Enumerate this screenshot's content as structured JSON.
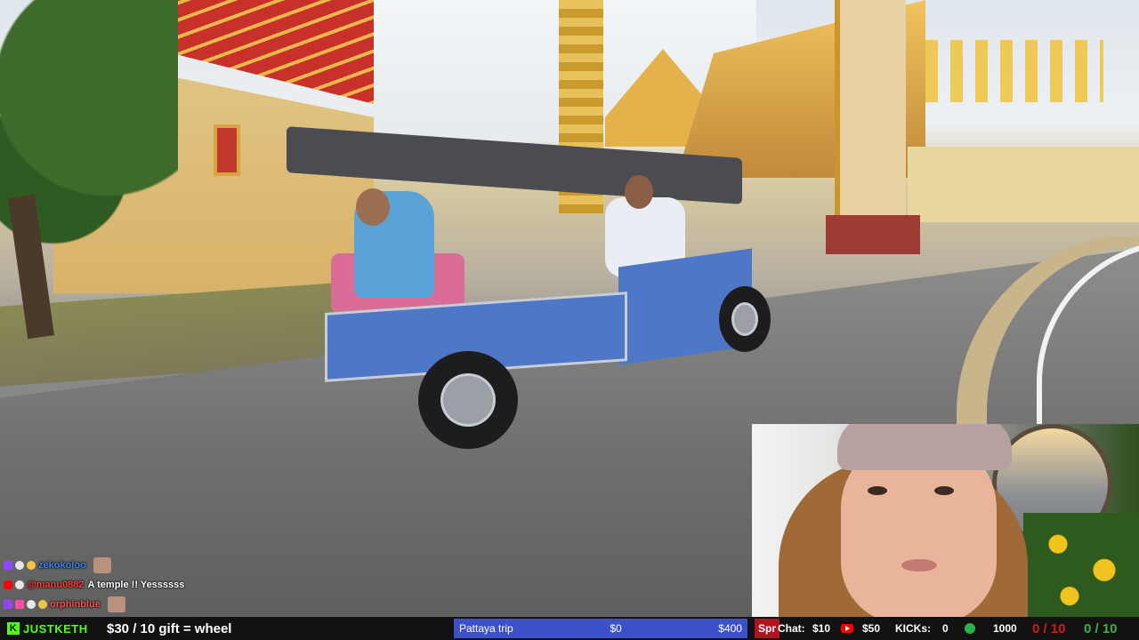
{
  "scene": {
    "description_icon": "stream-video"
  },
  "chat": [
    {
      "badges": [
        "twitch",
        "bw",
        "gold"
      ],
      "user": "zekokoloo",
      "user_color": "#3b82f6",
      "message": "",
      "emote": true
    },
    {
      "badges": [
        "yt",
        "bw"
      ],
      "user": "@manu0882",
      "user_color": "#ff3b3b",
      "message": "A temple !! Yessssss",
      "emote": false
    },
    {
      "badges": [
        "twitch",
        "heart",
        "bw",
        "gold"
      ],
      "user": "orphinblue",
      "user_color": "#ff4d4d",
      "message": "",
      "emote": true
    }
  ],
  "bottom_bar": {
    "logo": "JUSTKETH",
    "gift_goal": "$30 / 10 gift = wheel",
    "trip": {
      "label": "Pattaya trip",
      "current": "$0",
      "target": "$400"
    },
    "spr_label": "Spr",
    "chat_label": "Chat:",
    "chat_value": "$10",
    "yt_value": "$50",
    "kicks_label": "KICKs:",
    "kicks_value": "0",
    "kick_goal": "1000",
    "counter_red": "0 / 10",
    "counter_green": "0 / 10"
  },
  "colors": {
    "kick_green": "#53fc18",
    "trip_blue": "#3c50c8",
    "spr_red": "#b3121f",
    "counter_red": "#c81e1e",
    "counter_green": "#3fae4a"
  }
}
